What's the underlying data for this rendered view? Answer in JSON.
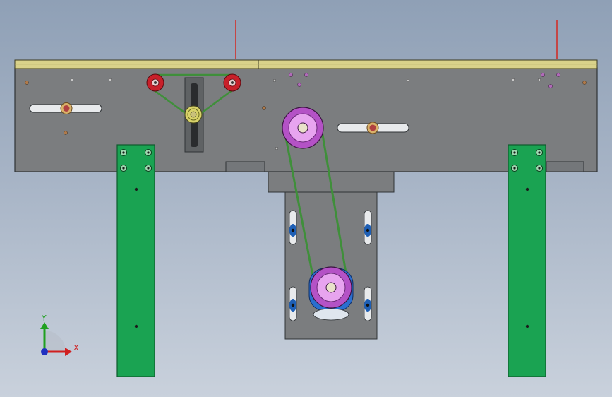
{
  "viewport": {
    "background_top": "#8fa0b6",
    "background_bottom": "#c9d1dc"
  },
  "colors": {
    "plate": "#7b7d7f",
    "plate_edge": "#2f3336",
    "top_rail": "#d9d28a",
    "leg": "#1aa352",
    "leg_edge": "#0d5a2c",
    "belt": "#3f8f3a",
    "pulley_outer": "#b452c6",
    "pulley_inner": "#e7a4ef",
    "idler_red": "#c8202a",
    "motor_blue": "#2a6fd0",
    "slot_blue": "#1e5fb5",
    "guide_rod": "#c44646"
  },
  "triad": {
    "x_label": "X",
    "y_label": "Y",
    "x_color": "#d02020",
    "y_color": "#20a020",
    "z_color": "#2030c0",
    "icon": "coordinate-axes-icon"
  }
}
